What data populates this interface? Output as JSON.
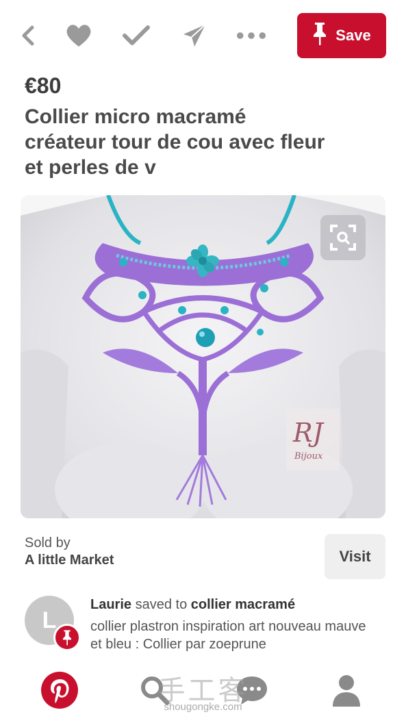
{
  "toolbar": {
    "icons": [
      "back-icon",
      "heart-icon",
      "check-icon",
      "send-icon",
      "more-icon"
    ],
    "save_label": "Save"
  },
  "pin": {
    "price": "€80",
    "title": "Collier micro macramé créateur tour de cou avec fleur et perles de v"
  },
  "photo": {
    "watermark_logo": "RJ Bijoux"
  },
  "seller": {
    "sold_by_label": "Sold by",
    "name": "A little Market",
    "visit_label": "Visit"
  },
  "activity": {
    "avatar_letter": "L",
    "user": "Laurie",
    "saved_to_text": "saved to",
    "board": "collier macramé",
    "description": "collier plastron inspiration art nouveau mauve et bleu : Collier par zoeprune"
  },
  "bottom_nav": {
    "items": [
      "pinterest-home-icon",
      "search-icon",
      "chat-icon",
      "profile-icon"
    ]
  },
  "watermark": {
    "text": "手工客",
    "url": "shougongke.com"
  },
  "colors": {
    "brand_red": "#c8102e",
    "icon_gray": "#9a9a9a"
  }
}
